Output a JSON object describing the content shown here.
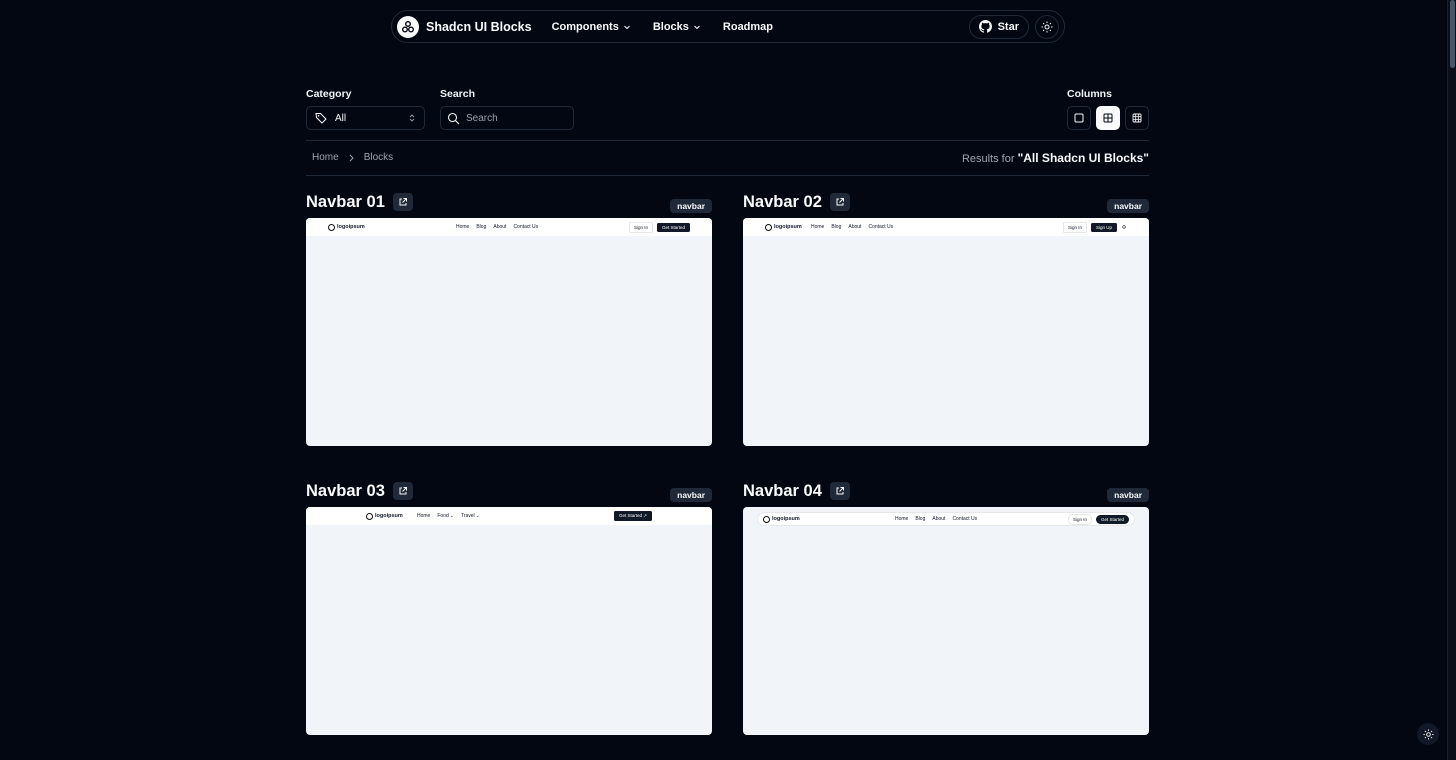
{
  "header": {
    "brand": "Shadcn UI Blocks",
    "nav": [
      "Components",
      "Blocks",
      "Roadmap"
    ],
    "star_label": "Star"
  },
  "filters": {
    "category_label": "Category",
    "category_value": "All",
    "search_label": "Search",
    "search_placeholder": "Search",
    "columns_label": "Columns"
  },
  "breadcrumb": [
    "Home",
    "Blocks"
  ],
  "results": {
    "prefix": "Results for",
    "query": "\"All Shadcn UI Blocks\""
  },
  "cards": [
    {
      "title": "Navbar 01",
      "tag": "navbar",
      "preview": {
        "logo": "logoipsum",
        "links": [
          "Home",
          "Blog",
          "About",
          "Contact Us"
        ],
        "secondary": "Sign In",
        "primary": "Get Started"
      }
    },
    {
      "title": "Navbar 02",
      "tag": "navbar",
      "preview": {
        "logo": "logoipsum",
        "links": [
          "Home",
          "Blog",
          "About",
          "Contact Us"
        ],
        "secondary": "Sign In",
        "primary": "Sign Up"
      }
    },
    {
      "title": "Navbar 03",
      "tag": "navbar",
      "preview": {
        "logo": "logoipsum",
        "links": [
          "Home",
          "Food",
          "Travel"
        ],
        "primary": "Get Started"
      }
    },
    {
      "title": "Navbar 04",
      "tag": "navbar",
      "preview": {
        "logo": "logoipsum",
        "links": [
          "Home",
          "Blog",
          "About",
          "Contact Us"
        ],
        "secondary": "Sign In",
        "primary": "Get Started"
      }
    }
  ],
  "colors": {
    "background": "#030712",
    "border": "#1f2937",
    "preview_bg": "#f1f5f9",
    "text": "#f8fafc",
    "muted": "#9ca3af"
  }
}
